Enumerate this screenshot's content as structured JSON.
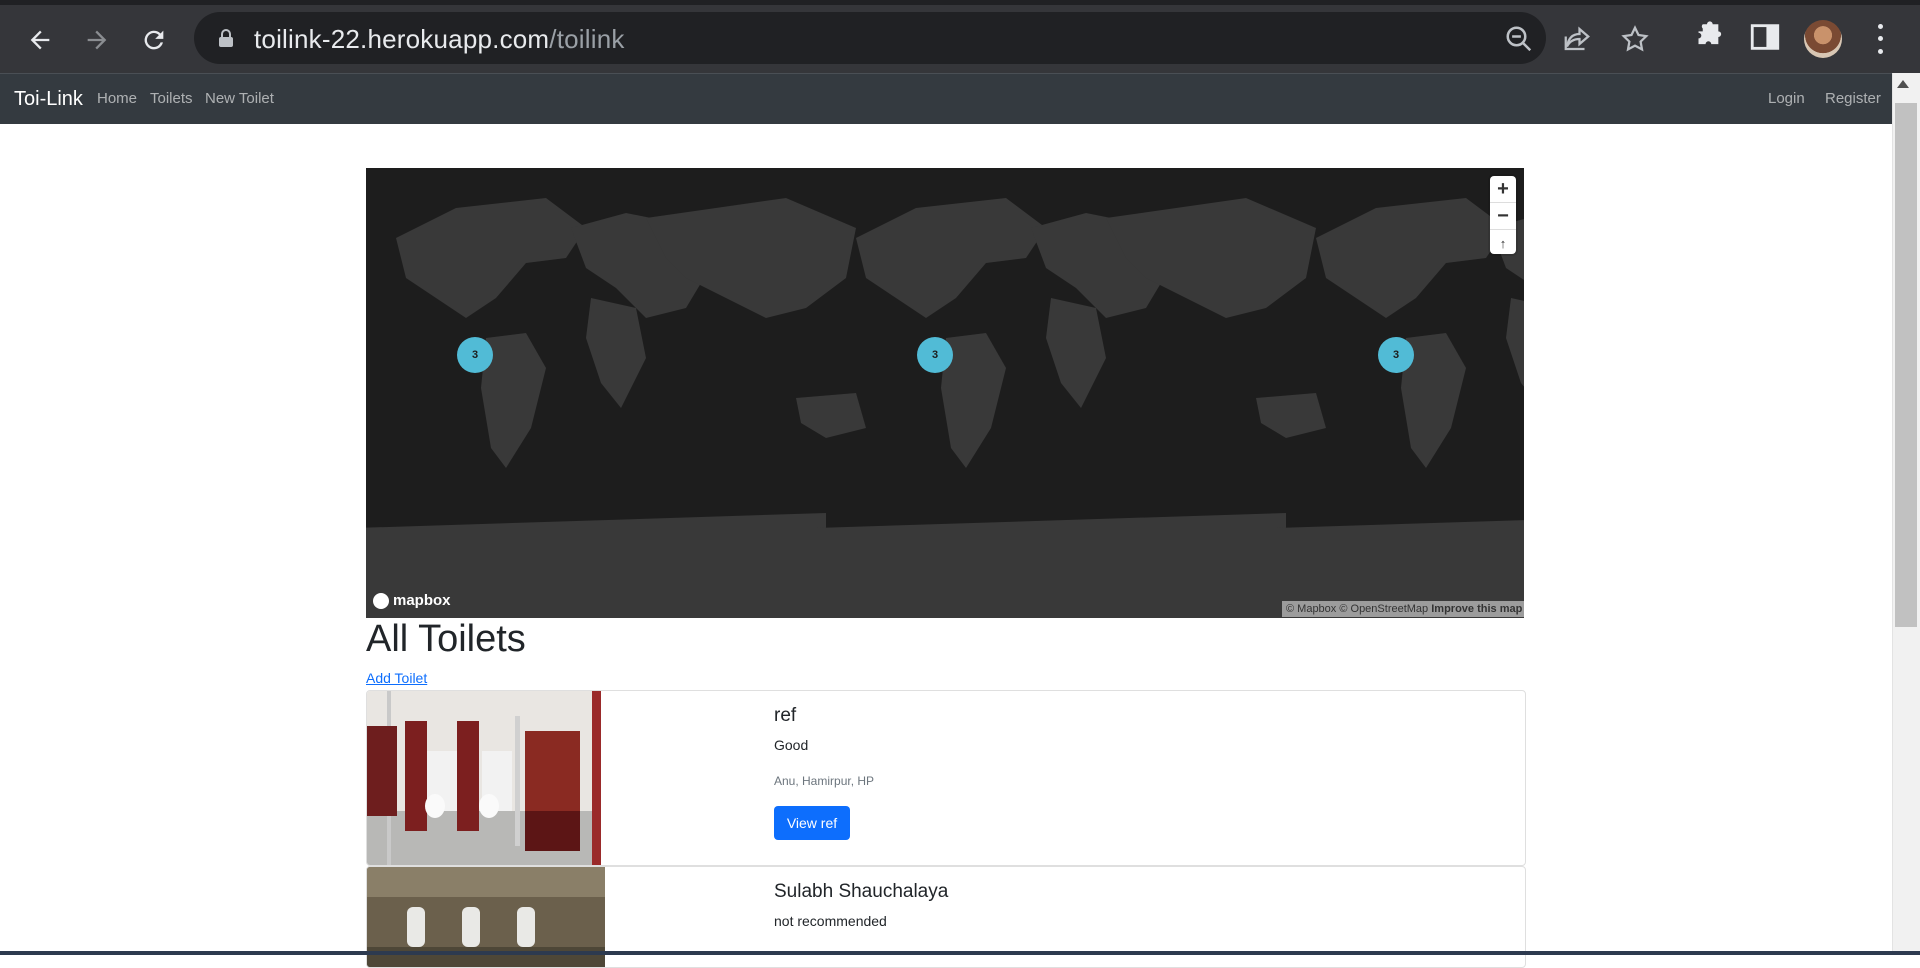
{
  "browser": {
    "url_host": "toilink-22.herokuapp.com",
    "url_path": "/toilink",
    "icons": [
      "back-icon",
      "forward-icon",
      "reload-icon",
      "lock-icon",
      "zoom-out-icon",
      "share-icon",
      "star-icon",
      "extensions-icon",
      "sidepanel-icon",
      "profile-avatar",
      "menu-icon"
    ]
  },
  "navbar": {
    "brand": "Toi-Link",
    "links": [
      "Home",
      "Toilets",
      "New Toilet"
    ],
    "right_links": [
      "Login",
      "Register"
    ]
  },
  "map": {
    "clusters": [
      "3",
      "3",
      "3"
    ],
    "zoom_in": "+",
    "zoom_out": "−",
    "compass": "↑",
    "logo": "mapbox",
    "attribution": "© Mapbox © OpenStreetMap",
    "improve": "Improve this map",
    "cluster_color": "#51bbd6",
    "land_color": "#393939",
    "water_color": "#1d1d1d"
  },
  "page": {
    "heading": "All Toilets",
    "add_link": "Add Toilet"
  },
  "toilets": [
    {
      "title": "ref",
      "desc": "Good",
      "location": "Anu, Hamirpur, HP",
      "button": "View ref"
    },
    {
      "title": "Sulabh Shauchalaya",
      "desc": "not recommended",
      "location": "",
      "button": ""
    }
  ]
}
